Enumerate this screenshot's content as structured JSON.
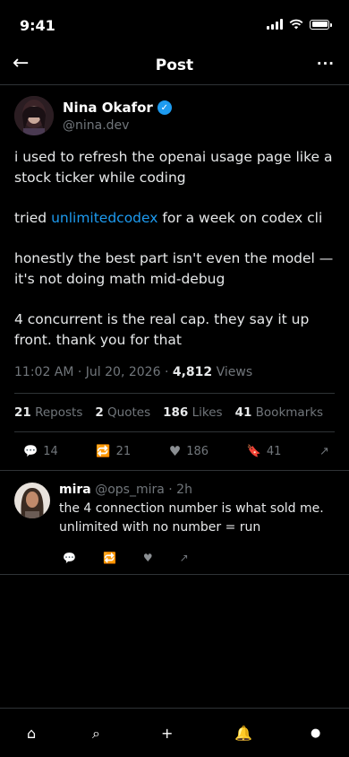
{
  "status": {
    "time": "9:41"
  },
  "nav": {
    "title": "Post",
    "back_icon": "←",
    "more_icon": "···"
  },
  "author": {
    "name": "Nina Okafor",
    "handle": "@nina.dev",
    "verified_icon": "✓"
  },
  "post": {
    "p1": "i used to refresh the openai usage page like a stock ticker while coding",
    "p2_pre": "tried ",
    "p2_link": "unlimitedcodex",
    "p2_post": " for a week on codex cli",
    "p3": "honestly the best part isn't even the model — it's not doing math mid-debug",
    "p4": "4 concurrent is the real cap. they say it up front. thank you for that"
  },
  "meta": {
    "time": "11:02 AM · Jul 20, 2026 · ",
    "views_count": "4,812",
    "views_label": " Views"
  },
  "stats": {
    "reposts_n": "21",
    "reposts_label": " Reposts",
    "quotes_n": "2",
    "quotes_label": " Quotes",
    "likes_n": "186",
    "likes_label": " Likes",
    "bookmarks_n": "41",
    "bookmarks_label": " Bookmarks"
  },
  "actions": {
    "replies": "14",
    "reposts": "21",
    "likes": "186",
    "bookmarks": "41",
    "icons": {
      "reply": "💬",
      "repost": "🔁",
      "like": "♥",
      "bookmark": "🔖",
      "share": "↗"
    }
  },
  "reply": {
    "name": "mira",
    "handle_time": " @ops_mira · 2h",
    "text": "the 4 connection number is what sold me. unlimited with no number = run"
  },
  "tabbar": {
    "home": "⌂",
    "search": "⌕",
    "compose": "+",
    "notifications": "🔔",
    "profile": "●"
  },
  "colors": {
    "accent": "#1d9bf0",
    "bg": "#000000",
    "muted": "#71767b"
  }
}
